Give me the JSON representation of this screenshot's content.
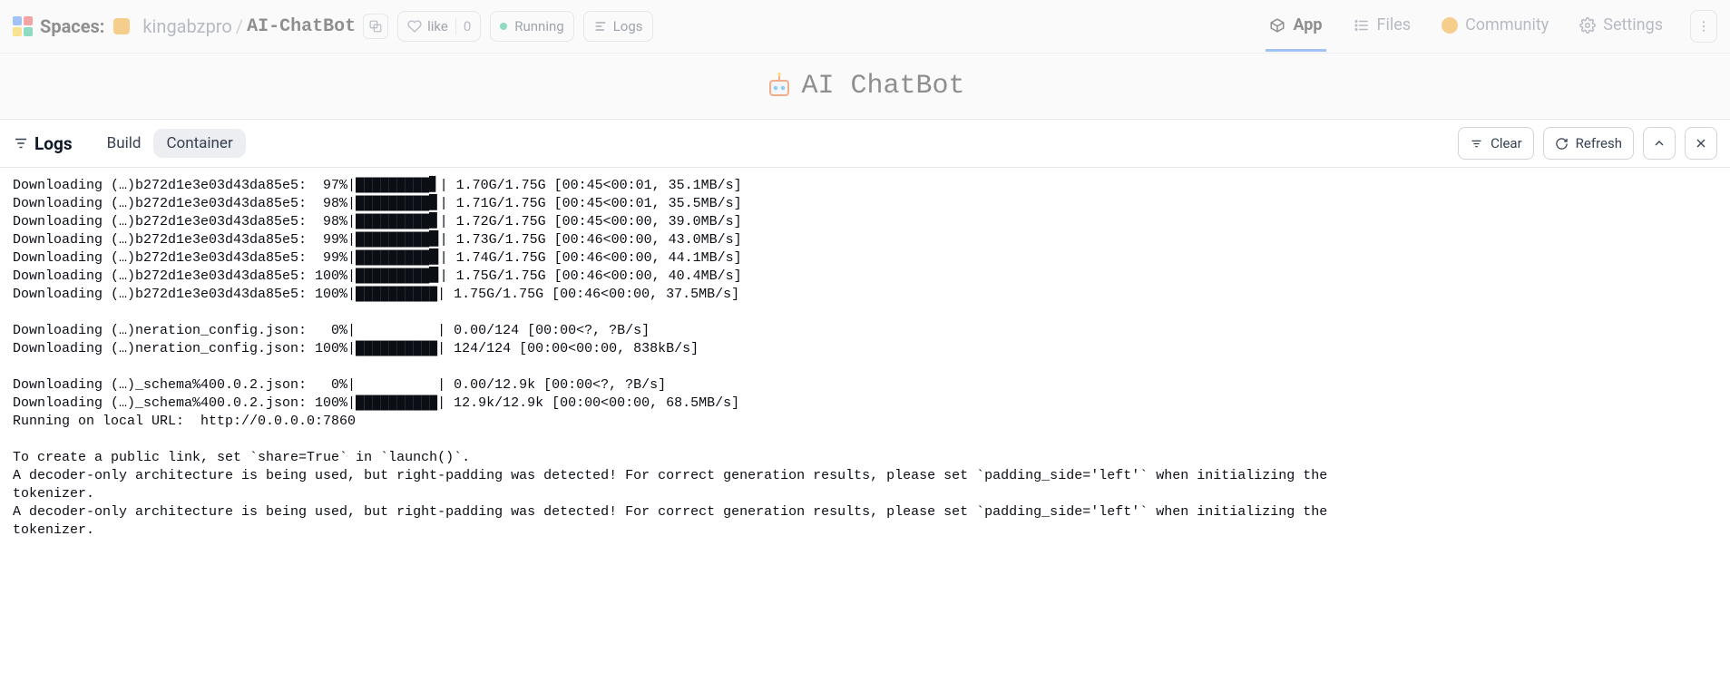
{
  "header": {
    "spaces_label": "Spaces:",
    "owner": "kingabzpro",
    "repo": "AI-ChatBot",
    "like_label": "like",
    "like_count": "0",
    "status_label": "Running",
    "logs_button": "Logs",
    "nav": {
      "app": "App",
      "files": "Files",
      "community": "Community",
      "settings": "Settings"
    }
  },
  "hero": {
    "title": "AI ChatBot"
  },
  "logs_panel": {
    "title": "Logs",
    "tab_build": "Build",
    "tab_container": "Container",
    "clear": "Clear",
    "refresh": "Refresh"
  },
  "logs_text": "Downloading (…)b272d1e3e03d43da85e5:  97%|█████████▋| 1.70G/1.75G [00:45<00:01, 35.1MB/s]\nDownloading (…)b272d1e3e03d43da85e5:  98%|█████████▊| 1.71G/1.75G [00:45<00:01, 35.5MB/s]\nDownloading (…)b272d1e3e03d43da85e5:  98%|█████████▊| 1.72G/1.75G [00:45<00:00, 39.0MB/s]\nDownloading (…)b272d1e3e03d43da85e5:  99%|█████████▉| 1.73G/1.75G [00:46<00:00, 43.0MB/s]\nDownloading (…)b272d1e3e03d43da85e5:  99%|█████████▉| 1.74G/1.75G [00:46<00:00, 44.1MB/s]\nDownloading (…)b272d1e3e03d43da85e5: 100%|█████████▉| 1.75G/1.75G [00:46<00:00, 40.4MB/s]\nDownloading (…)b272d1e3e03d43da85e5: 100%|██████████| 1.75G/1.75G [00:46<00:00, 37.5MB/s]\n\nDownloading (…)neration_config.json:   0%|          | 0.00/124 [00:00<?, ?B/s]\nDownloading (…)neration_config.json: 100%|██████████| 124/124 [00:00<00:00, 838kB/s]\n\nDownloading (…)_schema%400.0.2.json:   0%|          | 0.00/12.9k [00:00<?, ?B/s]\nDownloading (…)_schema%400.0.2.json: 100%|██████████| 12.9k/12.9k [00:00<00:00, 68.5MB/s]\nRunning on local URL:  http://0.0.0.0:7860\n\nTo create a public link, set `share=True` in `launch()`.\nA decoder-only architecture is being used, but right-padding was detected! For correct generation results, please set `padding_side='left'` when initializing the\ntokenizer.\nA decoder-only architecture is being used, but right-padding was detected! For correct generation results, please set `padding_side='left'` when initializing the\ntokenizer."
}
